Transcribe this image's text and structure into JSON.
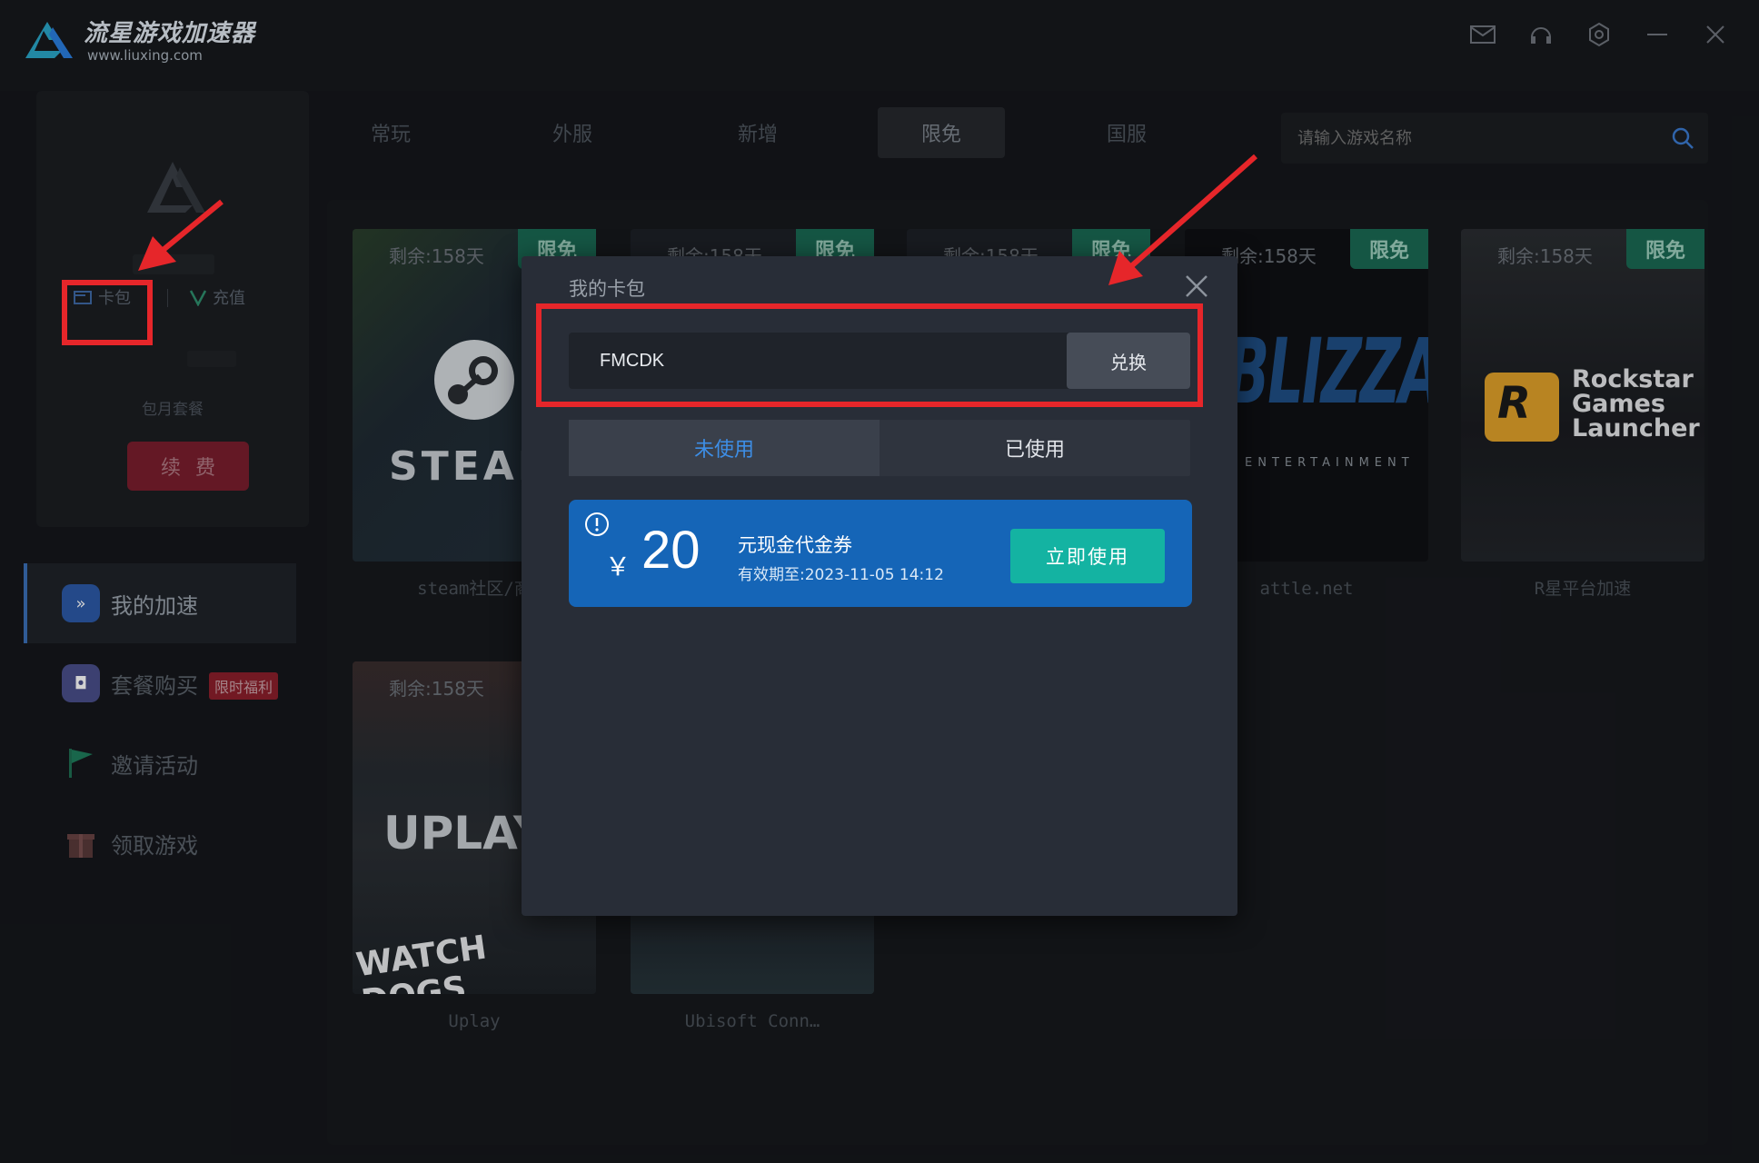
{
  "app": {
    "name": "流星游戏加速器",
    "url": "www.liuxing.com"
  },
  "window_controls": [
    "mail-icon",
    "headset-icon",
    "settings-icon",
    "minimize-icon",
    "close-icon"
  ],
  "sidebar": {
    "wallet_label": "卡包",
    "recharge_label": "充值",
    "plan_label": "包月套餐",
    "renew_label": "续费",
    "nav": [
      {
        "label": "我的加速",
        "icon": "speed-icon",
        "active": true
      },
      {
        "label": "套餐购买",
        "icon": "bag-icon",
        "badge": "限时福利"
      },
      {
        "label": "邀请活动",
        "icon": "flag-icon"
      },
      {
        "label": "领取游戏",
        "icon": "gift-icon"
      }
    ]
  },
  "tabs": [
    {
      "label": "常玩"
    },
    {
      "label": "外服"
    },
    {
      "label": "新增"
    },
    {
      "label": "限免",
      "active": true
    },
    {
      "label": "国服"
    }
  ],
  "search": {
    "placeholder": "请输入游戏名称"
  },
  "cards": [
    {
      "remain": "剩余:158天",
      "tag": "限免",
      "caption": "steam社区/商",
      "art": "STEAM"
    },
    {
      "remain": "剩余:158天",
      "tag": "限免",
      "caption": "",
      "art": ""
    },
    {
      "remain": "剩余:158天",
      "tag": "限免",
      "caption": "",
      "art": ""
    },
    {
      "remain": "剩余:158天",
      "tag": "限免",
      "caption": "attle.net",
      "art": "BLIZZARD"
    },
    {
      "remain": "剩余:158天",
      "tag": "限免",
      "caption": "R星平台加速",
      "art": "Rockstar Games Launcher"
    },
    {
      "remain": "剩余:158天",
      "tag": "",
      "caption": "Uplay",
      "art": "UPLAY"
    },
    {
      "remain": "",
      "tag": "",
      "caption": "Ubisoft Conn…",
      "art": "WATCH DOGS"
    }
  ],
  "modal": {
    "title": "我的卡包",
    "code_value": "FMCDK",
    "redeem_label": "兑换",
    "tab_unused": "未使用",
    "tab_used": "已使用",
    "coupon": {
      "currency": "￥",
      "amount": "20",
      "title": "元现金代金券",
      "expiry": "有效期至:2023-11-05  14:12",
      "use_label": "立即使用"
    }
  },
  "colors": {
    "accent_blue": "#1565b7",
    "use_green": "#14b3a2",
    "highlight_red": "#e6262a",
    "free_tag": "#1a6a53"
  }
}
